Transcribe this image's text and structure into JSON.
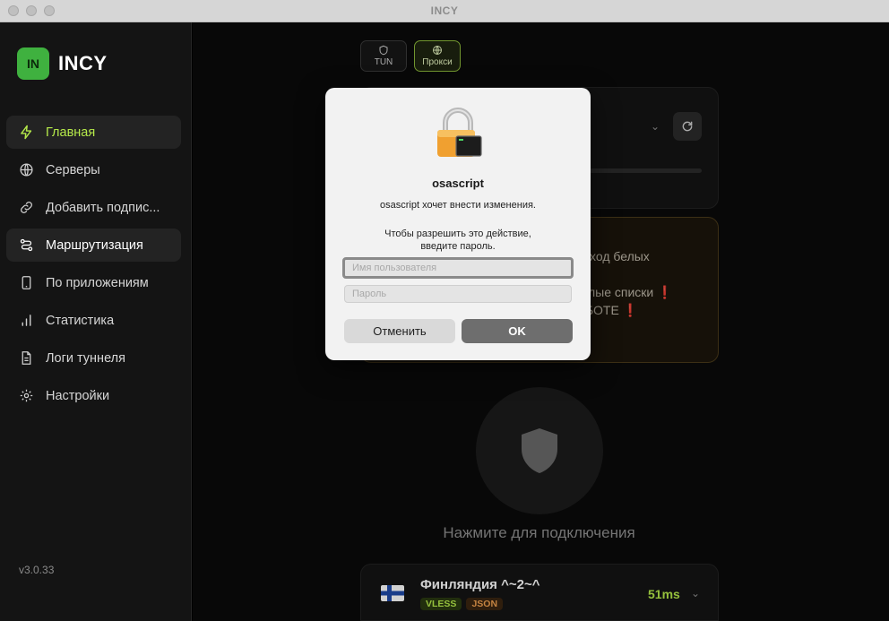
{
  "window": {
    "title": "INCY"
  },
  "sidebar": {
    "logo_badge": "IN",
    "logo_text": "INCY",
    "items": [
      {
        "label": "Главная"
      },
      {
        "label": "Серверы"
      },
      {
        "label": "Добавить подпис..."
      },
      {
        "label": "Маршрутизация"
      },
      {
        "label": "По приложениям"
      },
      {
        "label": "Статистика"
      },
      {
        "label": "Логи туннеля"
      },
      {
        "label": "Настройки"
      }
    ],
    "version": "v3.0.33"
  },
  "main": {
    "modes": [
      {
        "label": "TUN"
      },
      {
        "label": "Прокси"
      }
    ],
    "notice": {
      "line1": "ход белых",
      "line2": "лые списки",
      "line3": "БОТЕ",
      "mark": "❗"
    },
    "connect_hint": "Нажмите для подключения",
    "server": {
      "name": "Финляндия ^~2~^",
      "tags": [
        "VLESS",
        "JSON"
      ],
      "ping": "51ms"
    }
  },
  "dialog": {
    "title": "osascript",
    "message": "osascript хочет внести изменения.",
    "prompt_line1": "Чтобы разрешить это действие,",
    "prompt_line2": "введите пароль.",
    "username_placeholder": "Имя пользователя",
    "password_placeholder": "Пароль",
    "cancel_label": "Отменить",
    "ok_label": "OK"
  }
}
